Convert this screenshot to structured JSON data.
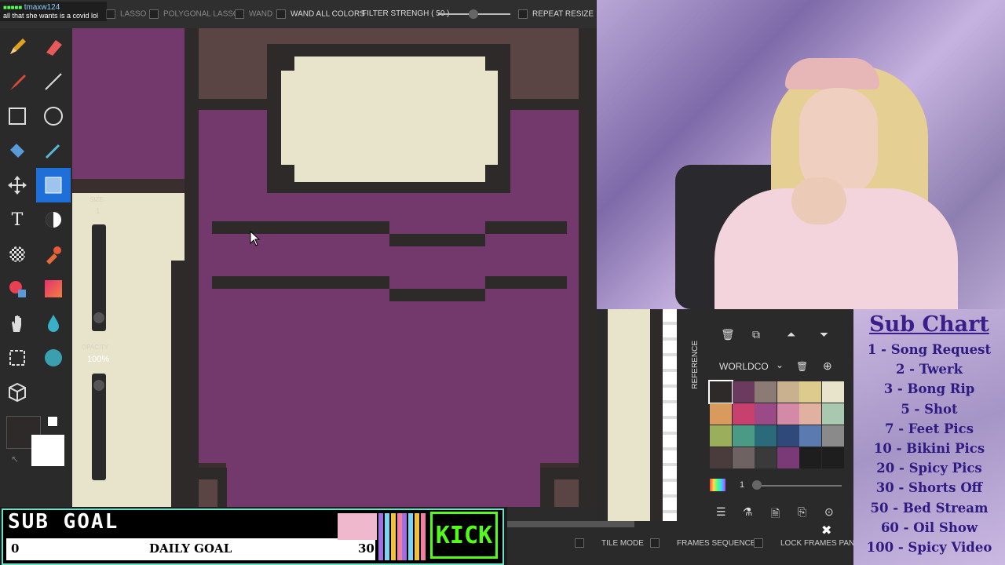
{
  "chat": {
    "username": "tmaxw124",
    "message": "all that she wants is a covid lol"
  },
  "toolbar": {
    "lasso": "LASSO",
    "polygonal_lasso": "POLYGONAL LASSO",
    "wand": "WAND",
    "wand_all_colors": "WAND ALL COLORS",
    "filter_strength": "FILTER STRENGH ( 50 )",
    "filter_strength_value": 50,
    "repeat_resize": "REPEAT RESIZE"
  },
  "left_panel": {
    "size_label": "SIZE",
    "size_value": "1",
    "opacity_label": "OPACITY",
    "opacity_value": "100%"
  },
  "tools": [
    "pencil-icon",
    "eraser-icon",
    "brush-icon",
    "line-icon",
    "rectangle-icon",
    "circle-icon",
    "fill-bucket-icon",
    "eyedropper-icon",
    "move-icon",
    "select-rect-icon",
    "text-icon",
    "dither-icon",
    "pattern-icon",
    "stamp-icon",
    "color-replace-icon",
    "gradient-icon",
    "hand-icon",
    "drop-icon",
    "crop-icon",
    "blob-icon",
    "cube-icon"
  ],
  "right_panel": {
    "reference_label": "REFERENCE",
    "palette_name": "WORLDCO",
    "layer_value": "1",
    "colors": {
      "primary": "#2e2a2a",
      "secondary": "#ffffff",
      "palette": [
        "#2e2a2a",
        "#6b3a5e",
        "#8c7a74",
        "#c9b190",
        "#dccb8c",
        "#e8e4cc",
        "#d99a5e",
        "#c8406e",
        "#9a4a86",
        "#d48aa6",
        "#e0b0a0",
        "#a8c8b0",
        "#9aae5c",
        "#4a9a86",
        "#2a6a7a",
        "#2f4a7a",
        "#5a7ab0",
        "#8a8a8a",
        "#4a3c3c",
        "#6e6262",
        "#3a3a3a",
        "#7a3a78",
        "#1e1e1e",
        "#1e1e1e"
      ]
    }
  },
  "bottom_bar": {
    "tile_mode": "TILE MODE",
    "frames_sequence": "FRAMES SEQUENCE",
    "lock_frames_panel": "LOCK FRAMES PANEL"
  },
  "sub_goal": {
    "title": "SUB GOAL",
    "current": "0",
    "label": "DAILY GOAL",
    "target": "30",
    "platform": "KICK"
  },
  "sub_chart": {
    "title": "Sub Chart",
    "items": [
      "1 - Song Request",
      "2 - Twerk",
      "3 - Bong Rip",
      "5 - Shot",
      "7 - Feet Pics",
      "10 - Bikini Pics",
      "20 - Spicy Pics",
      "30 - Shorts Off",
      "50 - Bed Stream",
      "60 - Oil Show",
      "100 - Spicy Video"
    ]
  }
}
